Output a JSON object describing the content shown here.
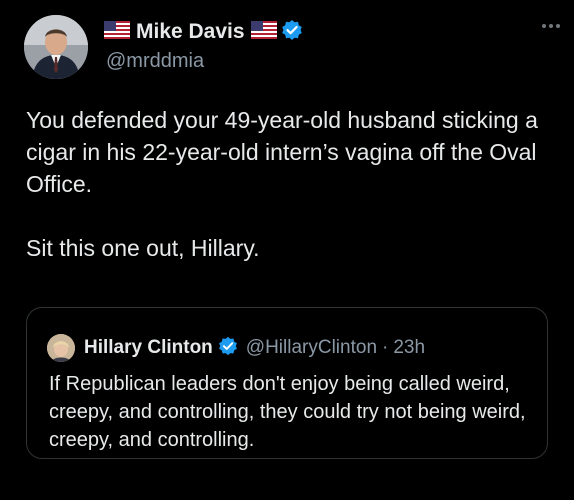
{
  "tweet": {
    "author": {
      "display_name": "Mike Davis",
      "handle": "@mrddmia",
      "flag_left_icon": "us-flag-icon",
      "flag_right_icon": "us-flag-icon",
      "verified_icon": "verified-badge-icon",
      "avatar_icon": "profile-avatar"
    },
    "more_icon": "more-options-icon",
    "text": {
      "paragraph_1": "You defended your 49-year-old husband sticking a cigar in his 22-year-old intern’s vagina off the Oval Office.",
      "paragraph_2": "Sit this one out, Hillary."
    },
    "quoted_tweet": {
      "display_name": "Hillary Clinton",
      "handle": "@HillaryClinton",
      "separator": "·",
      "time": "23h",
      "verified_icon": "verified-badge-icon",
      "text": "If Republican leaders don't enjoy being called weird, creepy, and controlling, they could try not being weird, creepy, and controlling."
    }
  },
  "colors": {
    "background": "#000000",
    "text_primary": "#e7e9ea",
    "text_secondary": "#8b98a5",
    "verified_blue": "#1d9bf0",
    "border": "#2f3336"
  }
}
